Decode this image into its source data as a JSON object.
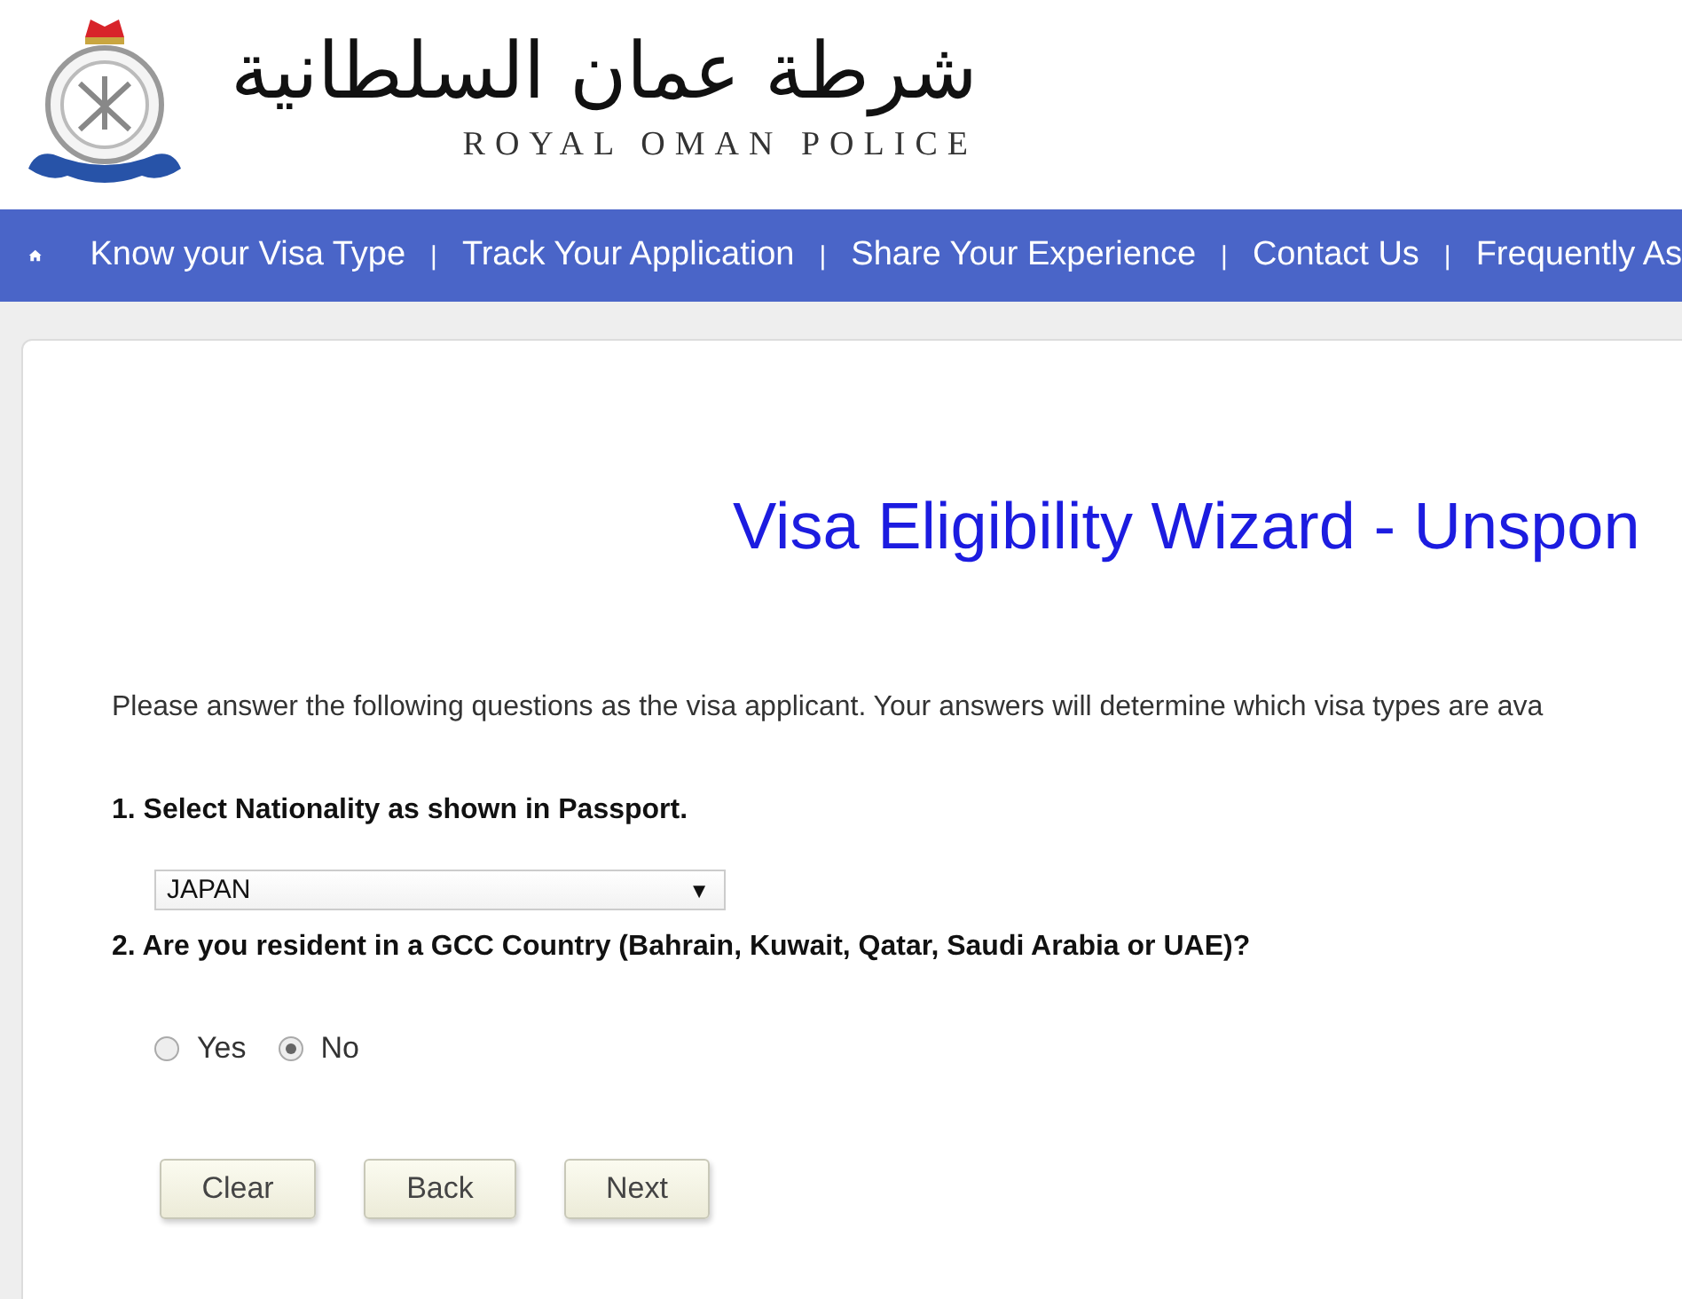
{
  "header": {
    "arabic_name": "شرطة عمان السلطانية",
    "english_name": "ROYAL OMAN POLICE"
  },
  "nav": {
    "items": [
      {
        "label": "Know your Visa Type"
      },
      {
        "label": "Track Your Application"
      },
      {
        "label": "Share Your Experience"
      },
      {
        "label": "Contact Us"
      },
      {
        "label": "Frequently As"
      }
    ],
    "separator": "|"
  },
  "wizard": {
    "title": "Visa Eligibility Wizard - Unspon",
    "intro": "Please answer the following questions as the visa applicant. Your answers will determine which visa types are ava",
    "questions": [
      {
        "kind": "select",
        "label": "1. Select Nationality as shown in Passport.",
        "value": "JAPAN",
        "caret": "▼"
      },
      {
        "kind": "radio",
        "label": "2. Are you resident in a GCC Country (Bahrain, Kuwait, Qatar, Saudi Arabia or UAE)?",
        "options": [
          {
            "label": "Yes",
            "selected": false
          },
          {
            "label": "No",
            "selected": true
          }
        ]
      }
    ],
    "buttons": [
      "Clear",
      "Back",
      "Next"
    ]
  }
}
